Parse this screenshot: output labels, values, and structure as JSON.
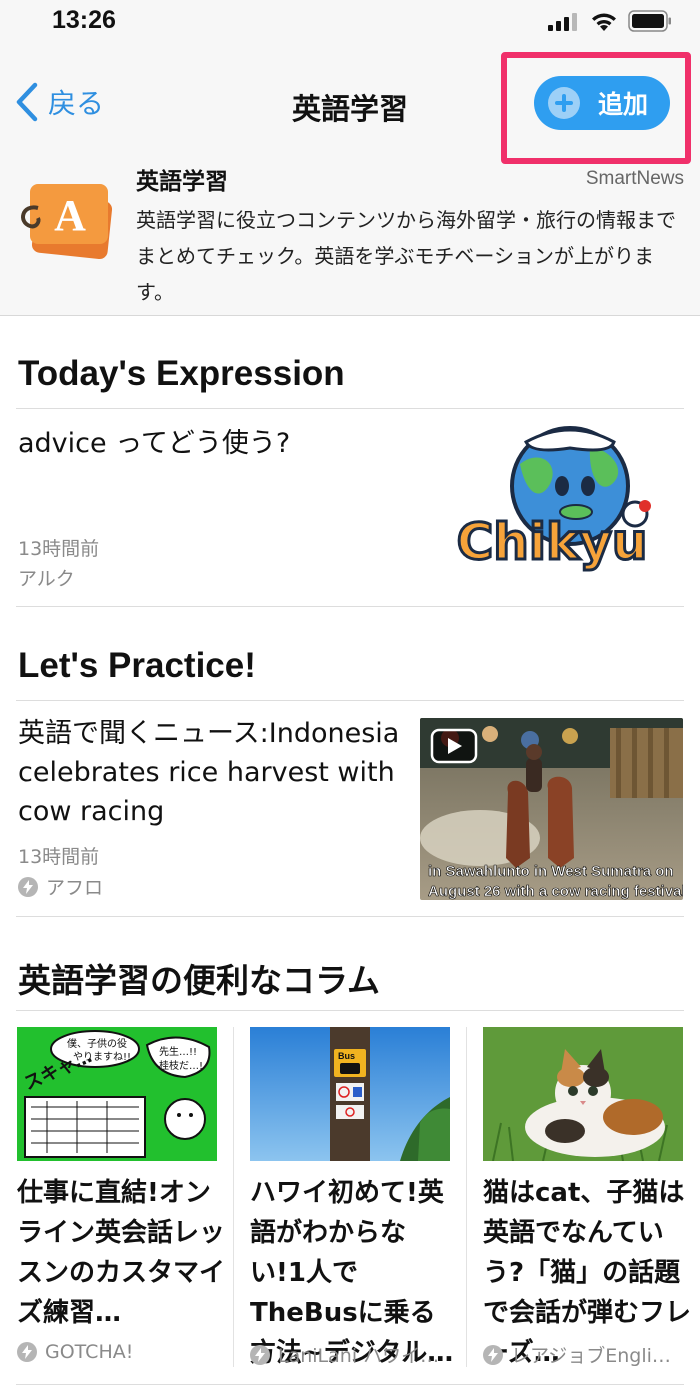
{
  "status_bar": {
    "time": "13:26"
  },
  "nav": {
    "back_label": "戻る",
    "title": "英語学習",
    "add_label": "追加"
  },
  "channel": {
    "name": "英語学習",
    "source": "SmartNews",
    "description": "英語学習に役立つコンテンツから海外留学・旅行の情報までまとめてチェック。英語を学ぶモチベーションが上がります。",
    "icon_letter": "A"
  },
  "sections": {
    "today": {
      "title": "Today's Expression",
      "article": {
        "title": "advice ってどう使う?",
        "time": "13時間前",
        "source": "アルク",
        "thumb_text": "Chikyu"
      }
    },
    "practice": {
      "title": "Let's Practice!",
      "article": {
        "title": "英語で聞くニュース:Indonesia celebrates rice harvest with cow racing",
        "time": "13時間前",
        "source": "アフロ",
        "video_caption_1": "in Sawahlunto in West Sumatra on",
        "video_caption_2": "August 26 with a cow racing festival."
      }
    },
    "columns": {
      "title": "英語学習の便利なコラム",
      "items": [
        {
          "title": "仕事に直結!オンライン英会話レッスンのカスタマイズ練習…",
          "source": "GOTCHA!",
          "img_text_1": "僕、子供の役",
          "img_text_2": "やりますね!!",
          "img_text_3": "先生…!!",
          "img_text_4": "桂枝だ…!",
          "img_text_5": "スキャ…"
        },
        {
          "title": "ハワイ初めて!英語がわからない!1人でTheBusに乗る方法~デジタル…",
          "source": "LaniLani ハワイ…",
          "img_text_1": "Bus"
        },
        {
          "title": "猫はcat、子猫は英語でなんていう?「猫」の話題で会話が弾むフレーズ…",
          "source": "レアジョブEngli…"
        }
      ]
    }
  }
}
